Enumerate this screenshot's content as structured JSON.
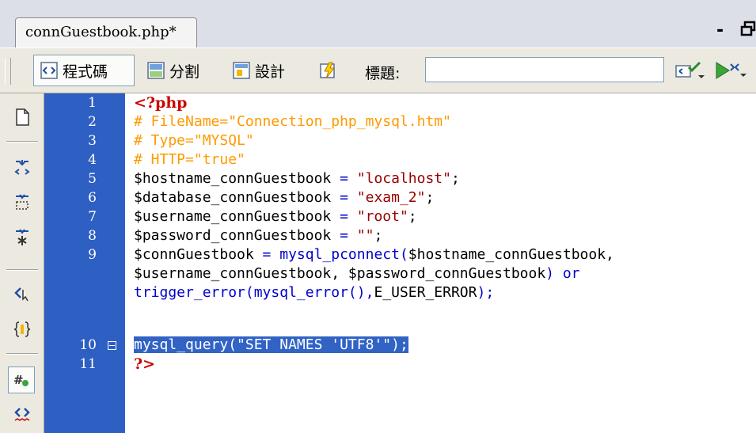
{
  "tab": {
    "filename": "connGuestbook.php*"
  },
  "window": {
    "minimize_glyph": "-"
  },
  "toolbar": {
    "code_view_label": "程式碼",
    "split_view_label": "分割",
    "design_view_label": "設計",
    "title_label": "標題:",
    "title_value": "",
    "icons": [
      "code-view-icon",
      "split-view-icon",
      "design-view-icon",
      "live-data-icon",
      "validate-icon",
      "preview-icon"
    ]
  },
  "gutter": {
    "icons": [
      "open-documents-icon",
      "collapse-full-tag-icon",
      "collapse-selection-icon",
      "expand-all-icon",
      "select-parent-tag-icon",
      "balance-braces-icon",
      "line-numbers-icon",
      "highlight-invalid-code-icon"
    ]
  },
  "colors": {
    "line_number_bg": "#2e5fc2",
    "selection_bg": "#3163c5",
    "php_tag": "#cc0000",
    "comment": "#ff9900",
    "string": "#990000",
    "function": "#0000cc"
  },
  "editor": {
    "line_numbers": [
      "1",
      "2",
      "3",
      "4",
      "5",
      "6",
      "7",
      "8",
      "9",
      "",
      "",
      "10",
      "11"
    ],
    "lines": {
      "l1": "<?php",
      "l2": "# FileName=\"Connection_php_mysql.htm\"",
      "l3": "# Type=\"MYSQL\"",
      "l4": "# HTTP=\"true\"",
      "l5_var": "$hostname_connGuestbook",
      "l5_op": " = ",
      "l5_str": "\"localhost\"",
      "l5_end": ";",
      "l6_var": "$database_connGuestbook",
      "l6_op": " = ",
      "l6_str": "\"exam_2\"",
      "l6_end": ";",
      "l7_var": "$username_connGuestbook",
      "l7_op": " = ",
      "l7_str": "\"root\"",
      "l7_end": ";",
      "l8_var": "$password_connGuestbook",
      "l8_op": " = ",
      "l8_str": "\"\"",
      "l8_end": ";",
      "l9_var": "$connGuestbook",
      "l9_op": " = ",
      "l9_fn": "mysql_pconnect(",
      "l9_args": "$hostname_connGuestbook,",
      "l9b_args": "$username_connGuestbook, $password_connGuestbook",
      "l9b_fn": ") or",
      "l9c_fn1": "trigger_error(",
      "l9c_fn2": "mysql_error(),",
      "l9c_const": "E_USER_ERROR",
      "l9c_end": ");",
      "l10": "mysql_query(\"SET NAMES 'UTF8'\");",
      "l11": "?>"
    }
  }
}
